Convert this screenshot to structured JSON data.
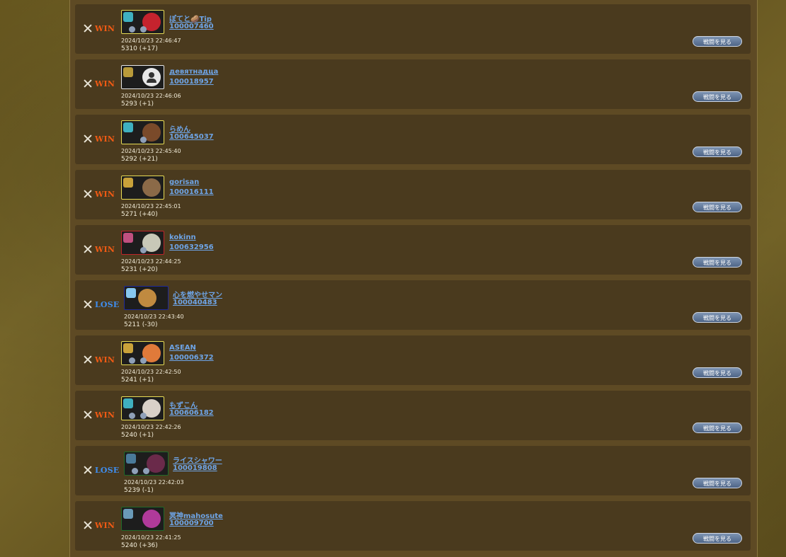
{
  "battle_list": {
    "watch_label": "戦闘を見る",
    "entries": [
      {
        "result": "WIN",
        "result_type": "win",
        "name": "ぽてと🥔Tip",
        "id": "100007460",
        "datetime": "2024/10/23 22:46:47",
        "score": "5310 (+17)",
        "frame_color": "#e8dc55",
        "emblem_color": "#3fb0c0",
        "char_color": "#c5232e"
      },
      {
        "result": "WIN",
        "result_type": "win",
        "name": "девятнадцa",
        "id": "100018957",
        "datetime": "2024/10/23 22:46:06",
        "score": "5293 (+1)",
        "frame_color": "#e8e8e8",
        "emblem_color": "#b89a3a",
        "char_color": "default"
      },
      {
        "result": "WIN",
        "result_type": "win",
        "name": "らめん",
        "id": "100645037",
        "datetime": "2024/10/23 22:45:40",
        "score": "5292 (+21)",
        "frame_color": "#e8dc55",
        "emblem_color": "#3fb0c0",
        "char_color": "#7a4a2a"
      },
      {
        "result": "WIN",
        "result_type": "win",
        "name": "gorisan",
        "id": "100016111",
        "datetime": "2024/10/23 22:45:01",
        "score": "5271 (+40)",
        "frame_color": "#e8dc55",
        "emblem_color": "#c9a23a",
        "char_color": "#8b6a48"
      },
      {
        "result": "WIN",
        "result_type": "win",
        "name": "kokinn",
        "id": "100632956",
        "datetime": "2024/10/23 22:44:25",
        "score": "5231 (+20)",
        "frame_color": "#c0252a",
        "emblem_color": "#c05080",
        "char_color": "#c8c8b8"
      },
      {
        "result": "LOSE",
        "result_type": "lose",
        "name": "心を燃やせマン",
        "id": "100040483",
        "datetime": "2024/10/23 22:43:40",
        "score": "5211 (-30)",
        "frame_color": "#1f2a9a",
        "emblem_color": "#88c8f0",
        "char_color": "#c08a40"
      },
      {
        "result": "WIN",
        "result_type": "win",
        "name": "ASEAN",
        "id": "100006372",
        "datetime": "2024/10/23 22:42:50",
        "score": "5241 (+1)",
        "frame_color": "#e8dc55",
        "emblem_color": "#c9a23a",
        "char_color": "#e07a3a"
      },
      {
        "result": "WIN",
        "result_type": "win",
        "name": "もずこん",
        "id": "100606182",
        "datetime": "2024/10/23 22:42:26",
        "score": "5240 (+1)",
        "frame_color": "#e8dc55",
        "emblem_color": "#3fb0c0",
        "char_color": "#d8d0c8"
      },
      {
        "result": "LOSE",
        "result_type": "lose",
        "name": "ライスシャワー",
        "id": "100019808",
        "datetime": "2024/10/23 22:42:03",
        "score": "5239 (-1)",
        "frame_color": "#1f6a2a",
        "emblem_color": "#4a7a9a",
        "char_color": "#6a2a4a"
      },
      {
        "result": "WIN",
        "result_type": "win",
        "name": "冥神mahosute",
        "id": "100009700",
        "datetime": "2024/10/23 22:41:25",
        "score": "5240 (+36)",
        "frame_color": "#1f6a2a",
        "emblem_color": "#6a9ab8",
        "char_color": "#b03a9a"
      }
    ]
  }
}
